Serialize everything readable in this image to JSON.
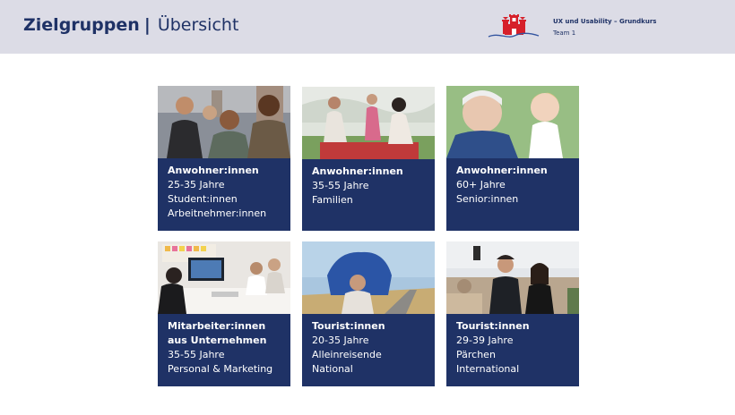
{
  "header": {
    "title_bold": "Zielgruppen",
    "title_separator": "|",
    "title_regular": "Übersicht",
    "course": "UX und Usability – Grundkurs",
    "team": "Team 1",
    "logo_icon": "hamburg-castle-logo-icon"
  },
  "colors": {
    "navy": "#1f3266",
    "header_bg": "#dcdce6",
    "logo_red": "#d6202a",
    "logo_wave": "#3355a0"
  },
  "cards": [
    {
      "heading": [
        "Anwohner:innen"
      ],
      "lines": [
        "25-35 Jahre",
        "Student:innen",
        "Arbeitnehmer:innen"
      ],
      "photo": "young-friends-laughing-city-photo"
    },
    {
      "heading": [
        "Anwohner:innen"
      ],
      "lines": [
        "35-55 Jahre",
        "Familien"
      ],
      "photo": "family-picnic-park-photo"
    },
    {
      "heading": [
        "Anwohner:innen"
      ],
      "lines": [
        "60+ Jahre",
        "Senior:innen"
      ],
      "photo": "grandfather-granddaughter-photo"
    },
    {
      "heading": [
        "Mitarbeiter:innen",
        "aus Unternehmen"
      ],
      "lines": [
        "35-55 Jahre",
        "Personal & Marketing"
      ],
      "photo": "office-meeting-photo"
    },
    {
      "heading": [
        "Tourist:innen"
      ],
      "lines": [
        "20-35 Jahre",
        "Alleinreisende",
        "National"
      ],
      "photo": "backpacker-road-photo"
    },
    {
      "heading": [
        "Tourist:innen"
      ],
      "lines": [
        "29-39 Jahre",
        "Pärchen",
        "International"
      ],
      "photo": "couple-selfie-city-photo"
    }
  ]
}
